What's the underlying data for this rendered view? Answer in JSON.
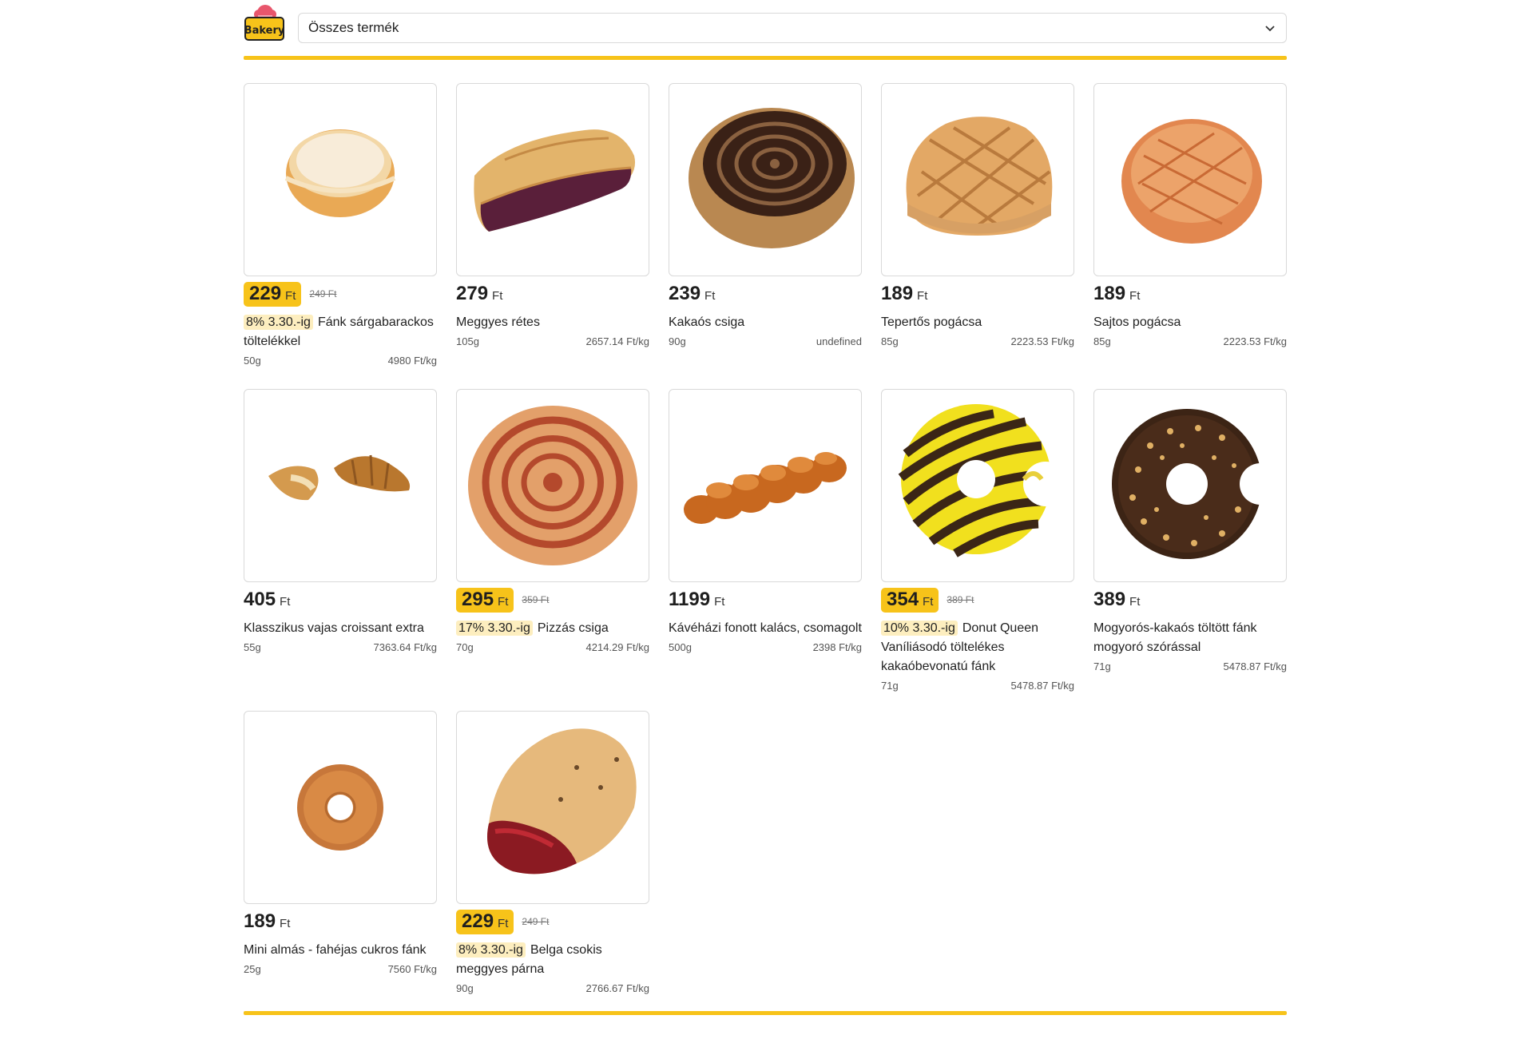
{
  "header": {
    "logo_text": "Bakery",
    "category_select": {
      "selected": "Összes termék"
    }
  },
  "colors": {
    "accent": "#f7c31a",
    "badge_bg": "#fdeebf"
  },
  "products": [
    {
      "price": "229",
      "currency": "Ft",
      "old_price": "249 Ft",
      "badge": "8% 3.30.-ig",
      "name": "Fánk sárgabarackos töltelékkel",
      "weight": "50g",
      "unit_price": "4980 Ft/kg",
      "icon": "apricot-donut-image"
    },
    {
      "price": "279",
      "currency": "Ft",
      "name": "Meggyes rétes",
      "weight": "105g",
      "unit_price": "2657.14 Ft/kg",
      "icon": "cherry-strudel-image"
    },
    {
      "price": "239",
      "currency": "Ft",
      "name": "Kakaós csiga",
      "weight": "90g",
      "unit_price": "undefined",
      "icon": "cocoa-roll-image"
    },
    {
      "price": "189",
      "currency": "Ft",
      "name": "Tepertős pogácsa",
      "weight": "85g",
      "unit_price": "2223.53 Ft/kg",
      "icon": "crackling-scone-image"
    },
    {
      "price": "189",
      "currency": "Ft",
      "name": "Sajtos pogácsa",
      "weight": "85g",
      "unit_price": "2223.53 Ft/kg",
      "icon": "cheese-scone-image"
    },
    {
      "price": "405",
      "currency": "Ft",
      "name": "Klasszikus vajas croissant extra",
      "weight": "55g",
      "unit_price": "7363.64 Ft/kg",
      "icon": "croissant-image"
    },
    {
      "price": "295",
      "currency": "Ft",
      "old_price": "359 Ft",
      "badge": "17% 3.30.-ig",
      "name": "Pizzás csiga",
      "weight": "70g",
      "unit_price": "4214.29 Ft/kg",
      "icon": "pizza-roll-image"
    },
    {
      "price": "1199",
      "currency": "Ft",
      "name": "Kávéházi fonott kalács, csomagolt",
      "weight": "500g",
      "unit_price": "2398 Ft/kg",
      "icon": "braided-bread-image"
    },
    {
      "price": "354",
      "currency": "Ft",
      "old_price": "389 Ft",
      "badge": "10% 3.30.-ig",
      "name": "Donut Queen Vaníliásodó töltelékes kakaóbevonatú fánk",
      "weight": "71g",
      "unit_price": "5478.87 Ft/kg",
      "icon": "striped-donut-image"
    },
    {
      "price": "389",
      "currency": "Ft",
      "name": "Mogyorós-kakaós töltött fánk mogyoró szórással",
      "weight": "71g",
      "unit_price": "5478.87 Ft/kg",
      "icon": "hazelnut-donut-image"
    },
    {
      "price": "189",
      "currency": "Ft",
      "name": "Mini almás - fahéjas cukros fánk",
      "weight": "25g",
      "unit_price": "7560 Ft/kg",
      "icon": "mini-donut-image"
    },
    {
      "price": "229",
      "currency": "Ft",
      "old_price": "249 Ft",
      "badge": "8% 3.30.-ig",
      "name": "Belga csokis meggyes párna",
      "weight": "90g",
      "unit_price": "2766.67 Ft/kg",
      "icon": "cherry-pillow-image"
    }
  ]
}
